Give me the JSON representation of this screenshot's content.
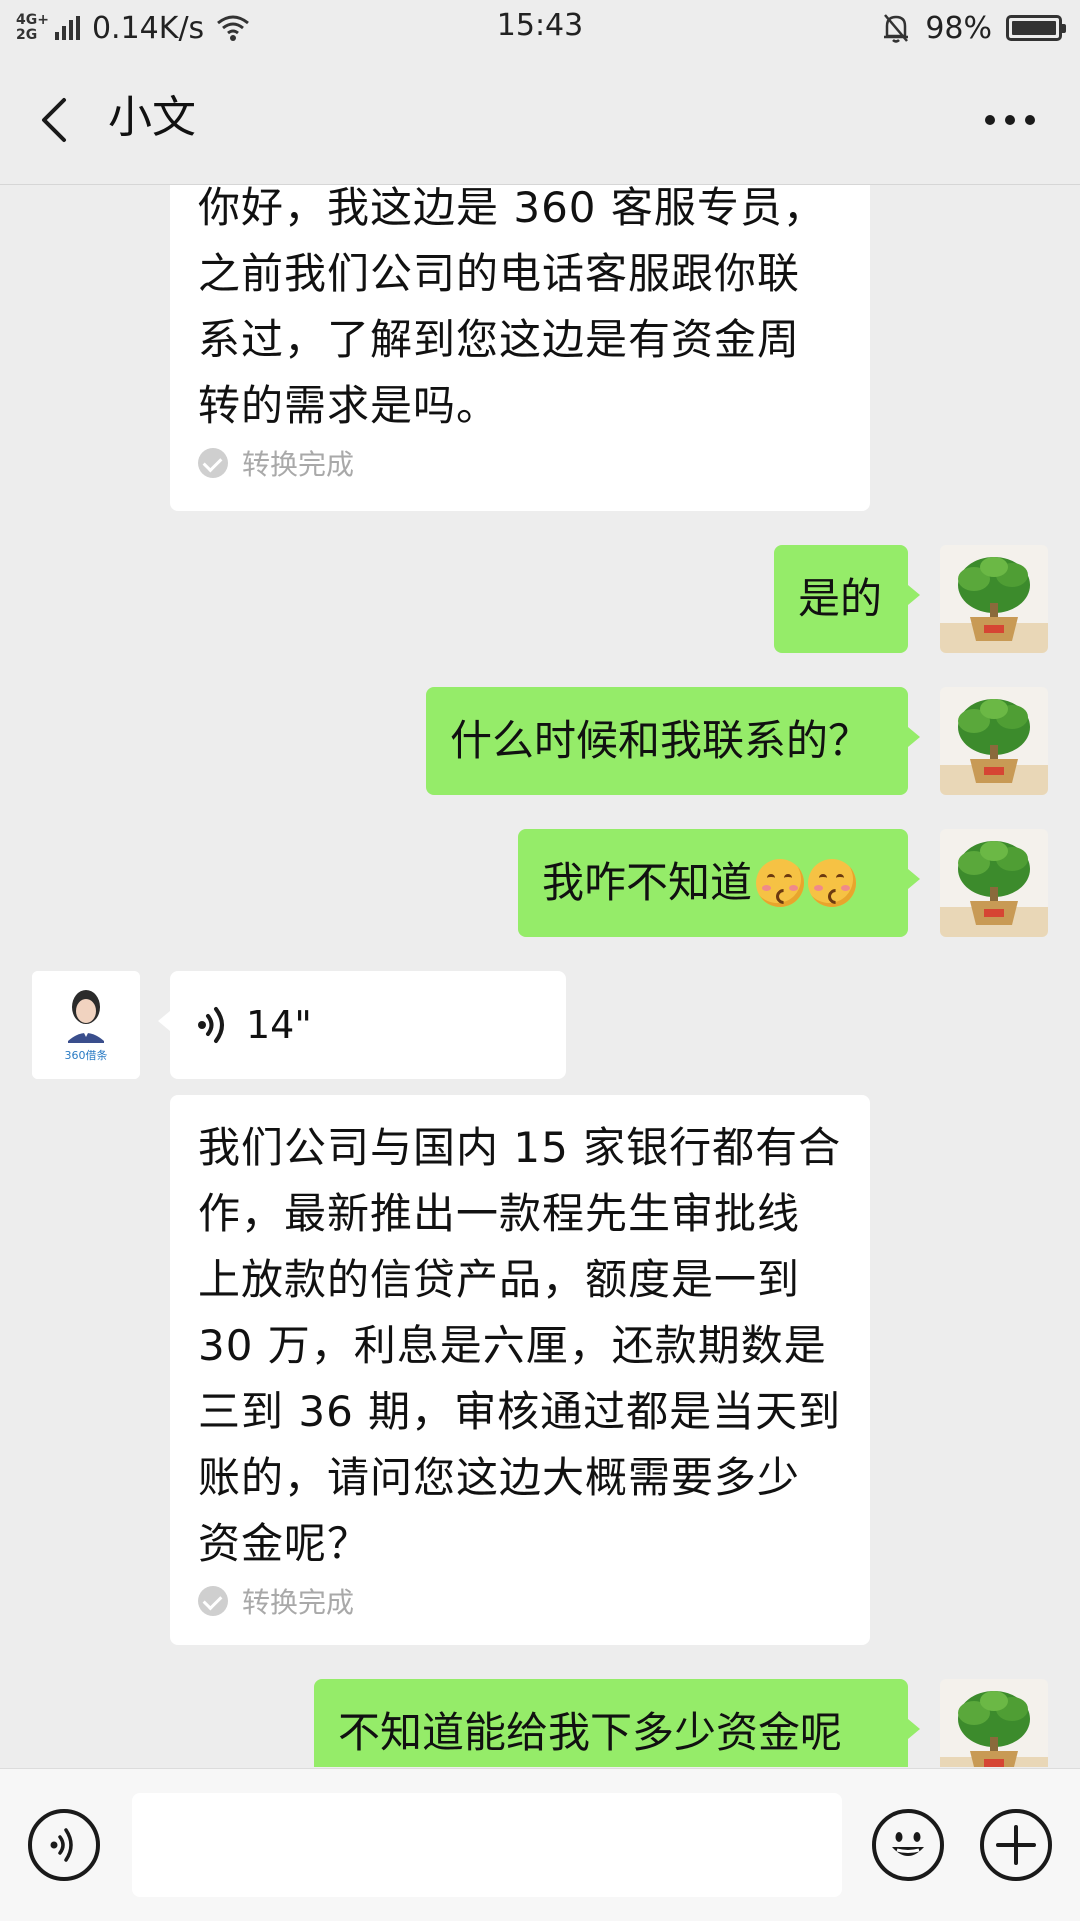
{
  "status_bar": {
    "network_top": "4G+",
    "network_bottom": "2G",
    "speed": "0.14K/s",
    "time": "15:43",
    "battery": "98%"
  },
  "header": {
    "title": "小文",
    "back_icon": "chevron-left-icon",
    "more_icon": "more-dots-icon"
  },
  "messages": [
    {
      "direction": "incoming",
      "type": "voice-transcript",
      "text": "你好，我这边是 360 客服专员，之前我们公司的电话客服跟你联系过，了解到您这边是有资金周转的需求是吗。",
      "lines": [
        "你好，我这边是 360 客服专员，",
        "之前我们公司的电话客服跟你联",
        "系过，了解到您这边是有资金周",
        "转的需求是吗。"
      ],
      "status": "转换完成"
    },
    {
      "direction": "outgoing",
      "type": "text",
      "text": "是的"
    },
    {
      "direction": "outgoing",
      "type": "text",
      "text": "什么时候和我联系的？"
    },
    {
      "direction": "outgoing",
      "type": "text",
      "text": "我咋不知道",
      "emoji": "weary-face-emoji"
    },
    {
      "direction": "incoming",
      "type": "voice",
      "duration": "14\""
    },
    {
      "direction": "incoming",
      "type": "voice-transcript",
      "lines": [
        "我们公司与国内 15 家银行都有合",
        "作，最新推出一款程先生审批线",
        "上放款的信贷产品，额度是一到",
        "30 万，利息是六厘，还款期数是",
        "三到 36 期，审核通过都是当天到",
        "账的，请问您这边大概需要多少",
        "资金呢？"
      ],
      "status": "转换完成"
    },
    {
      "direction": "outgoing",
      "type": "text",
      "text": "不知道能给我下多少资金呢"
    }
  ],
  "agent_avatar": {
    "caption": "360借条"
  },
  "colors": {
    "background": "#ededed",
    "outgoing_bubble": "#95ec69",
    "incoming_bubble": "#ffffff"
  },
  "input_bar": {
    "voice_icon": "voice-toggle-icon",
    "emoji_icon": "emoji-icon",
    "plus_icon": "plus-icon",
    "value": ""
  }
}
